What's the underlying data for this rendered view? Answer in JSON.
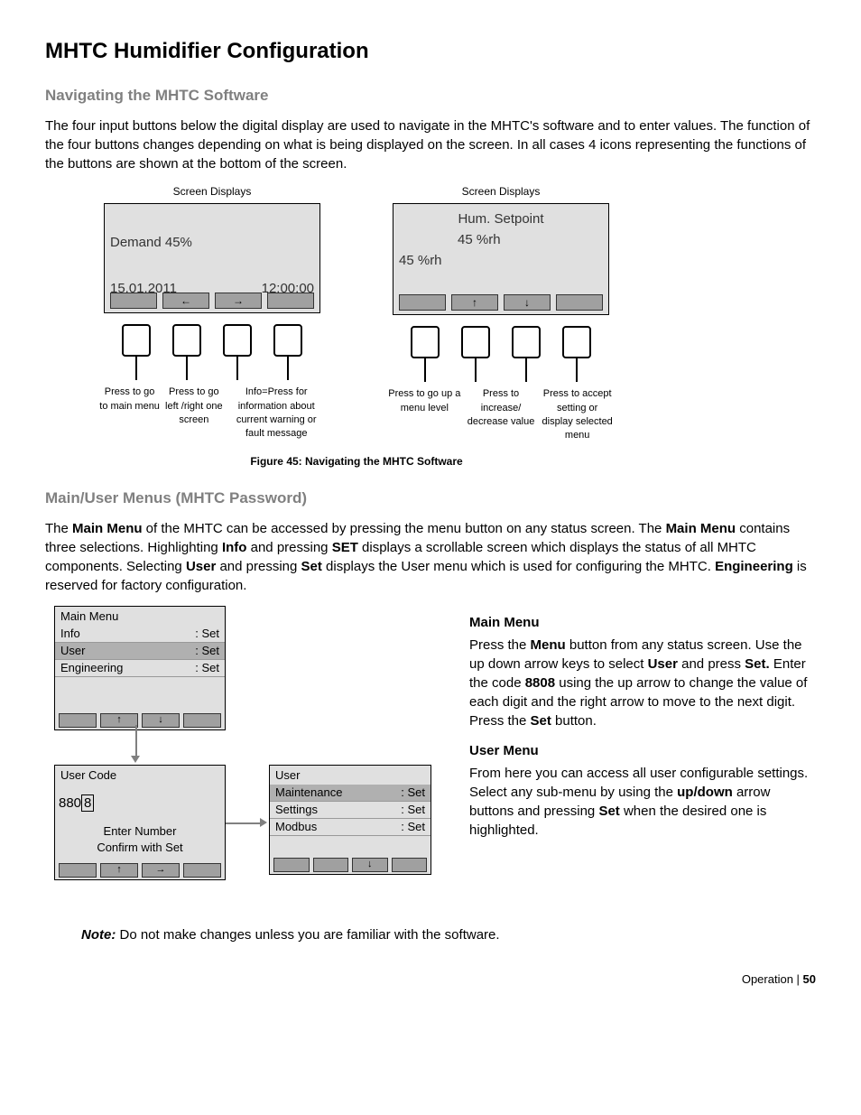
{
  "title": "MHTC Humidifier Configuration",
  "section1": {
    "heading": "Navigating the MHTC Software",
    "para": "The four input buttons below the digital display are used to navigate in the MHTC's software and to enter values.  The function of the four buttons changes depending on what is being displayed on the screen.  In all cases 4 icons representing the functions of the buttons are shown at the bottom of the screen."
  },
  "screenLabel": "Screen Displays",
  "screenA": {
    "line1": "Demand   45%",
    "date": "15.01.2011",
    "time": "12:00:00",
    "captions": [
      "Press to go to main menu",
      "Press to go left /right one screen",
      "Info=Press for information about current warning or fault message"
    ]
  },
  "screenB": {
    "line1": "Hum. Setpoint",
    "line2": "      45 %rh",
    "line3": "45 %rh",
    "captions": [
      "Press to go up a menu level",
      "Press to increase/ decrease value",
      "Press to accept setting or display selected menu"
    ]
  },
  "figCaption": "Figure 45: Navigating the MHTC Software",
  "section2": {
    "heading": "Main/User Menus  (MHTC Password)",
    "para_parts": {
      "p1": "The ",
      "b1": "Main Menu",
      "p2": " of the MHTC can be accessed by pressing the menu button on any status screen.  The ",
      "b2": "Main Menu",
      "p3": " contains three selections.  Highlighting ",
      "b3": "Info",
      "p4": " and pressing ",
      "b4": "SET",
      "p5": " displays a scrollable screen which displays the status of all MHTC components.  Selecting ",
      "b5": "User",
      "p6": " and pressing ",
      "b6": "Set",
      "p7": " displays the User menu which is used for configuring the MHTC.  ",
      "b7": "Engineering",
      "p8": " is reserved for factory configuration."
    }
  },
  "mainMenuScreen": {
    "title": "Main Menu",
    "rows": [
      {
        "label": "Info",
        "val": ": Set"
      },
      {
        "label": "User",
        "val": ": Set"
      },
      {
        "label": "Engineering",
        "val": ": Set"
      }
    ]
  },
  "userCodeScreen": {
    "title": "User Code",
    "prefix": "880",
    "editDigit": "8",
    "hint1": "Enter Number",
    "hint2": "Confirm with Set"
  },
  "userMenuScreen": {
    "title": "User",
    "rows": [
      {
        "label": "Maintenance",
        "val": ": Set"
      },
      {
        "label": "Settings",
        "val": ": Set"
      },
      {
        "label": "Modbus",
        "val": ": Set"
      }
    ]
  },
  "sideText": {
    "h1": "Main Menu",
    "p1_parts": {
      "a": "Press the ",
      "b1": "Menu",
      "b": " button from any status screen. Use the up down arrow keys to select ",
      "b2": "User",
      "c": " and press ",
      "b3": "Set.",
      "d": " Enter the code ",
      "b4": "8808",
      "e": " using the up arrow to change the value of each digit and the right arrow to move to the next digit.  Press the ",
      "b5": "Set",
      "f": " button."
    },
    "h2": "User Menu",
    "p2_parts": {
      "a": "From here you can access all user configurable settings.  Select any sub-menu by using the ",
      "b1": "up/down",
      "b": " arrow buttons and pressing ",
      "b2": "Set",
      "c": " when the desired one is highlighted."
    }
  },
  "note": {
    "label": "Note:",
    "text": " Do not make changes unless you are familiar with the software."
  },
  "footer": {
    "section": "Operation",
    "sep": " | ",
    "page": "50"
  }
}
